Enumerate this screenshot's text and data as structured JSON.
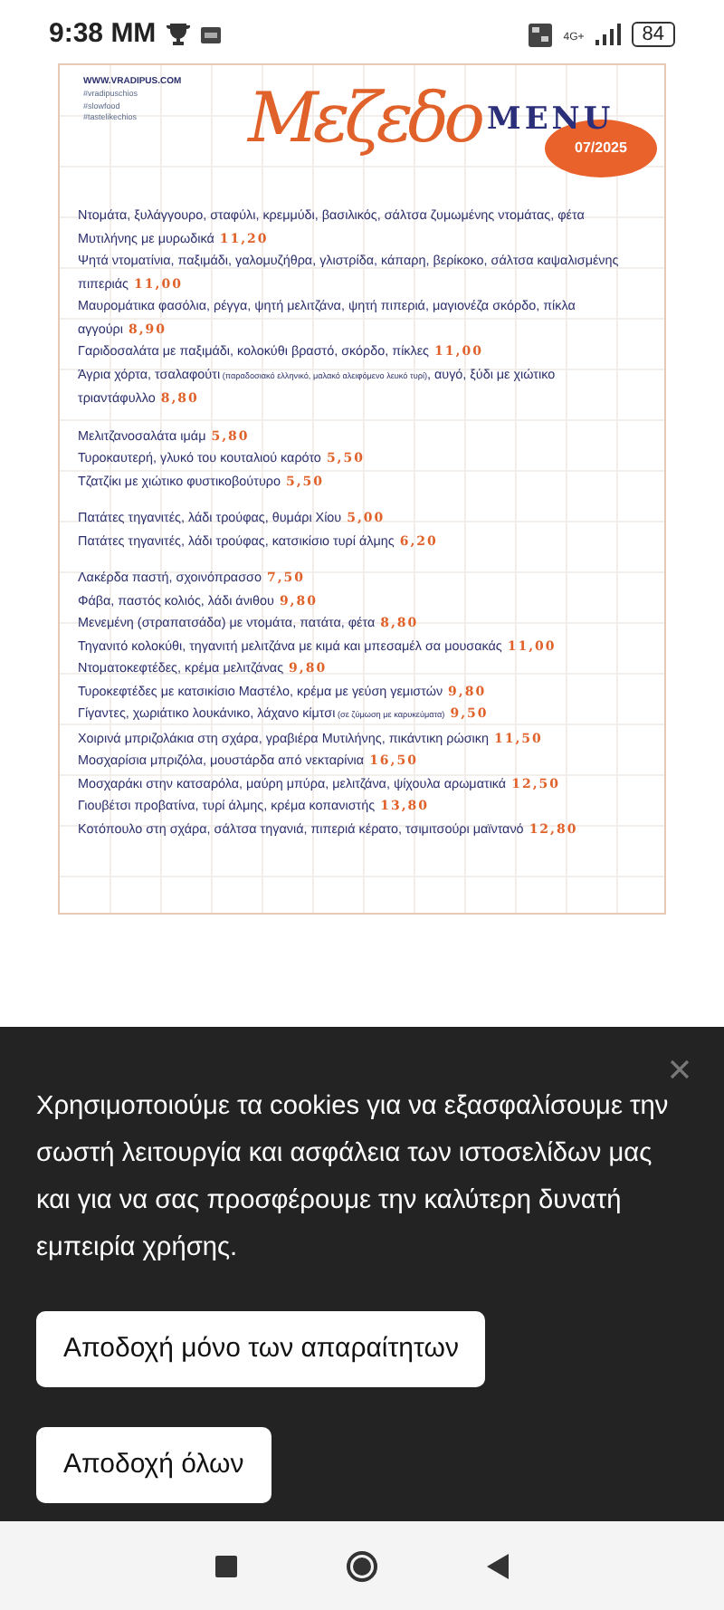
{
  "status_bar": {
    "time": "9:38 MM",
    "network": "4G+",
    "battery": "84"
  },
  "menu": {
    "website": "WWW.VRADIPUS.COM",
    "hashtags": [
      "#vradipuschios",
      "#slowfood",
      "#tastelikechios"
    ],
    "title_script": "Μεζεδο",
    "title": "MENU",
    "date": "07/2025",
    "groups": [
      [
        {
          "text": "Ντομάτα, ξυλάγγουρο, σταφύλι, κρεμμύδι, βασιλικός, σάλτσα ζυμωμένης ντομάτας, φέτα Μυτιλήνης με μυρωδικά",
          "price": "11,20"
        },
        {
          "text": "Ψητά ντοματίνια, παξιμάδι, γαλομυζήθρα, γλιστρίδα, κάπαρη, βερίκοκο, σάλτσα καψαλισμένης πιπεριάς",
          "price": "11,00"
        },
        {
          "text": "Μαυρομάτικα φασόλια, ρέγγα, ψητή μελιτζάνα, ψητή πιπεριά, μαγιονέζα σκόρδο, πίκλα αγγούρι",
          "price": "8,90"
        },
        {
          "text": "Γαριδοσαλάτα με παξιμάδι, κολοκύθι βραστό, σκόρδο, πίκλες",
          "price": "11,00"
        },
        {
          "text": "Άγρια χόρτα, τσαλαφούτι",
          "note": "(παραδοσιακό ελληνικό, μαλακό αλειφόμενο λευκό τυρί)",
          "text_after": ", αυγό, ξύδι με χιώτικο τριαντάφυλλο",
          "price": "8,80"
        }
      ],
      [
        {
          "text": "Μελιτζανοσαλάτα ιμάμ",
          "price": "5,80"
        },
        {
          "text": "Τυροκαυτερή, γλυκό του κουταλιού καρότο",
          "price": "5,50"
        },
        {
          "text": "Τζατζίκι με χιώτικο φυστικοβούτυρο",
          "price": "5,50"
        }
      ],
      [
        {
          "text": "Πατάτες τηγανιτές, λάδι τρούφας, θυμάρι Χίου",
          "price": "5,00"
        },
        {
          "text": "Πατάτες τηγανιτές, λάδι τρούφας, κατσικίσιο τυρί άλμης",
          "price": "6,20"
        }
      ],
      [
        {
          "text": "Λακέρδα παστή, σχοινόπρασσο",
          "price": "7,50"
        },
        {
          "text": "Φάβα, παστός κολιός, λάδι άνιθου",
          "price": "9,80"
        },
        {
          "text": "Μενεμένη (στραπατσάδα) με ντομάτα, πατάτα, φέτα",
          "price": "8,80"
        },
        {
          "text": "Τηγανιτό κολοκύθι, τηγανιτή μελιτζάνα με κιμά και μπεσαμέλ σα μουσακάς",
          "price": "11,00"
        },
        {
          "text": "Ντοματοκεφτέδες, κρέμα μελιτζάνας",
          "price": "9,80"
        },
        {
          "text": "Τυροκεφτέδες με κατσικίσιο Μαστέλο, κρέμα με γεύση γεμιστών",
          "price": "9,80"
        },
        {
          "text": "Γίγαντες, χωριάτικο λουκάνικο, λάχανο κίμτσι",
          "note": "(σε ζύμωση με καρυκεύματα)",
          "price": "9,50"
        },
        {
          "text": "Χοιρινά μπριζολάκια στη σχάρα, γραβιέρα Μυτιλήνης, πικάντικη ρώσικη",
          "price": "11,50"
        },
        {
          "text": "Μοσχαρίσια μπριζόλα, μουστάρδα από νεκταρίνια",
          "price": "16,50"
        },
        {
          "text": "Μοσχαράκι στην κατσαρόλα, μαύρη μπύρα,  μελιτζάνα, ψίχουλα αρωματικά",
          "price": "12,50"
        },
        {
          "text": "Γιουβέτσι προβατίνα, τυρί άλμης, κρέμα κοπανιστής",
          "price": "13,80"
        },
        {
          "text": "Κοτόπουλο στη σχάρα, σάλτσα τηγανιά, πιπεριά κέρατο, τσιμιτσούρι μαϊντανό",
          "price": "12,80"
        }
      ]
    ]
  },
  "cookie_banner": {
    "message": "Χρησιμοποιούμε τα cookies για να εξασφαλίσουμε την σωστή λειτουργία και ασφάλεια των ιστοσελίδων μας και για να σας προσφέρουμε την καλύτερη δυνατή εμπειρία χρήσης.",
    "buttons": [
      "Αποδοχή μόνο των απαραίτητων",
      "Αποδοχή όλων"
    ]
  }
}
